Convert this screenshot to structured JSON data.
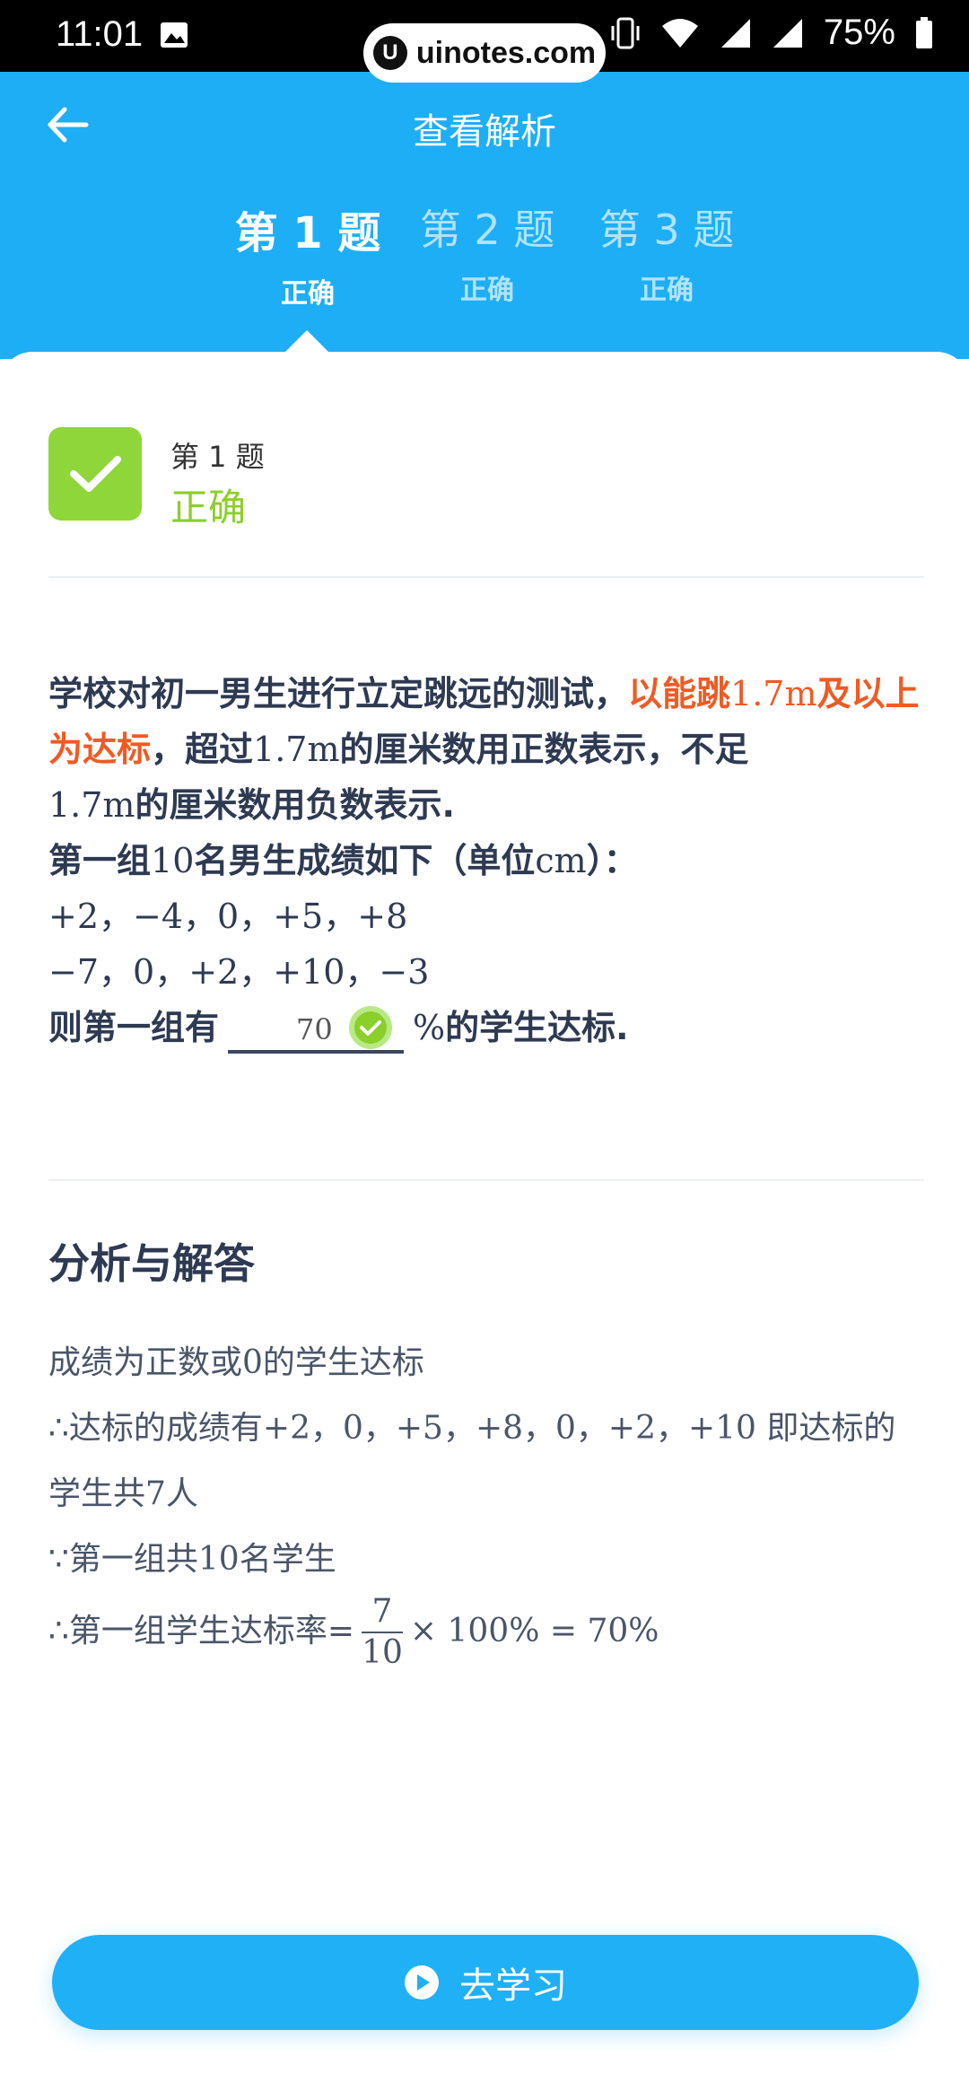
{
  "status_bar": {
    "time": "11:01",
    "battery": "75%"
  },
  "watermark": {
    "text": "uinotes.com"
  },
  "header": {
    "title": "查看解析",
    "tabs": [
      {
        "label": "第 1 题",
        "result": "正确"
      },
      {
        "label": "第 2 题",
        "result": "正确"
      },
      {
        "label": "第 3 题",
        "result": "正确"
      }
    ]
  },
  "result_card": {
    "label": "第 1 题",
    "result": "正确"
  },
  "question": {
    "p1": "学校对初一男生进行立定跳远的测试，",
    "p2_highlight": "以能跳",
    "p2_num": "1.7m",
    "p2_highlight2": "及以上为达标",
    "p3": "，超过",
    "p3_num": "1.7m",
    "p4": "的厘米数用正数表示，不足",
    "p4_num": "1.7m",
    "p5": "的厘米数用负数表示.",
    "line2a": "第一组",
    "line2_num": "10",
    "line2b": "名男生成绩如下（单位",
    "line2_unit": "cm",
    "line2c": "）：",
    "data_row1": "+2，−4，0，+5，+8",
    "data_row2": "−7，0，+2，+10，−3",
    "ask_prefix": "则第一组有",
    "answer_value": "70",
    "ask_percent": "%",
    "ask_suffix": "的学生达标."
  },
  "analysis": {
    "title": "分析与解答",
    "l1a": "成绩为正数或",
    "l1_num": "0",
    "l1b": "的学生达标",
    "l2a": "∴达标的成绩有",
    "l2_vals": "+2，0，+5，+8，0，+2，+10",
    "l2b": " 即达标的学生共",
    "l2_num": "7",
    "l2c": "人",
    "l3a": "∵第一组共",
    "l3_num": "10",
    "l3b": "名学生",
    "l4a": "∴第一组学生达标率=",
    "frac_num": "7",
    "frac_den": "10",
    "l4b": "× 100% = 70%"
  },
  "study_button": {
    "label": "去学习"
  }
}
